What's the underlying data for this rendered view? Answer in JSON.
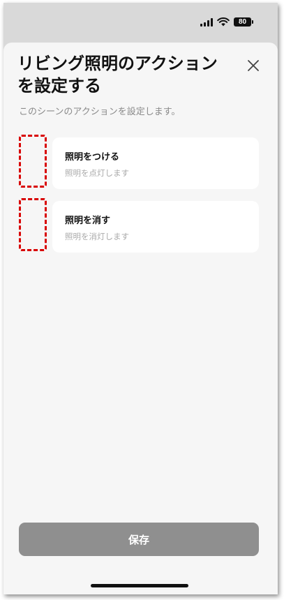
{
  "status_bar": {
    "battery_level": "80",
    "icons": [
      "signal-icon",
      "wifi-icon",
      "battery-icon"
    ]
  },
  "sheet": {
    "title_line1": "リビング照明のアクション",
    "title_line2": "を設定する",
    "subtitle": "このシーンのアクションを設定します。",
    "close_icon": "close-icon"
  },
  "actions": [
    {
      "title": "照明をつける",
      "description": "照明を点灯します"
    },
    {
      "title": "照明を消す",
      "description": "照明を消灯します"
    }
  ],
  "footer": {
    "save_label": "保存"
  },
  "colors": {
    "sheet_background": "#f6f6f6",
    "card_background": "#ffffff",
    "save_button": "#8f8f8f",
    "placeholder_dash": "#d80000"
  }
}
